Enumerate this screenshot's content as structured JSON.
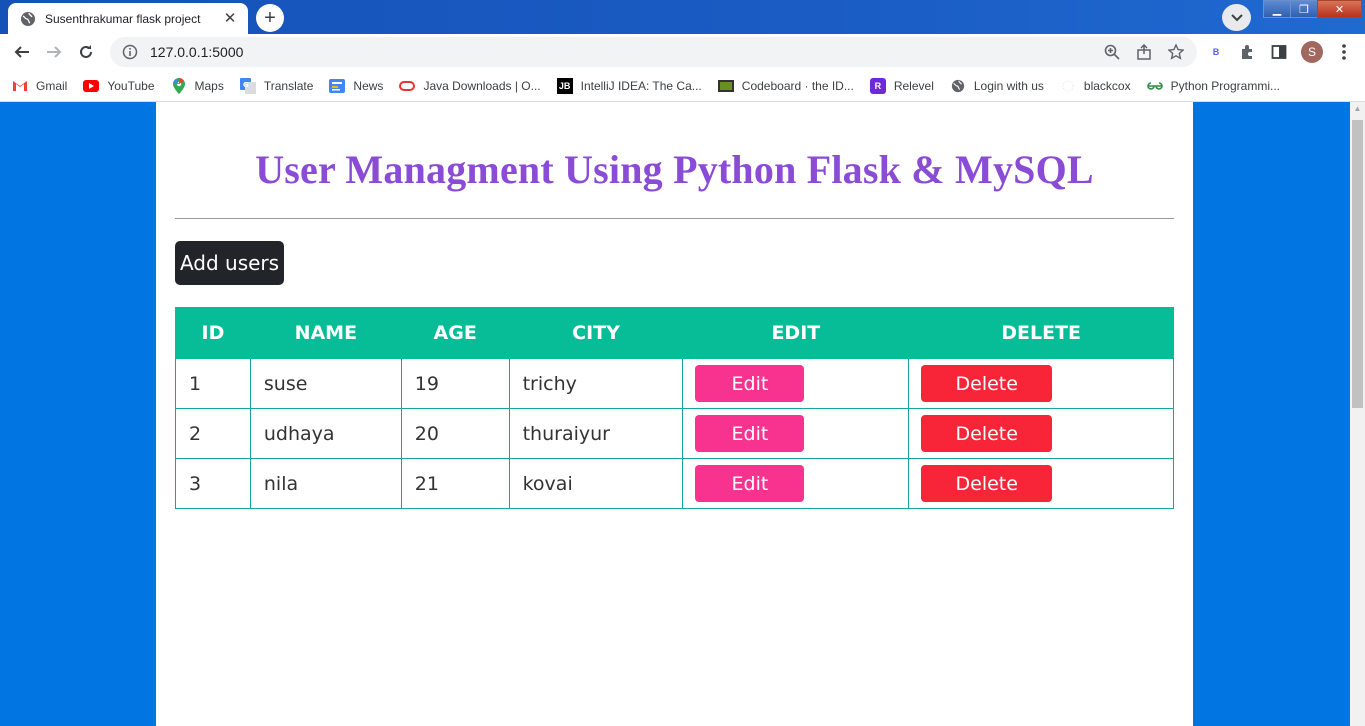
{
  "browser": {
    "tab_title": "Susenthrakumar flask project",
    "tab_close": "✕",
    "new_tab": "+",
    "url": "127.0.0.1:5000",
    "profile_initial": "S",
    "window_controls": {
      "minimize": "▁",
      "restore": "❐",
      "close": "✕"
    }
  },
  "bookmarks": [
    {
      "label": "Gmail",
      "icon": "gmail-icon"
    },
    {
      "label": "YouTube",
      "icon": "youtube-icon"
    },
    {
      "label": "Maps",
      "icon": "maps-icon"
    },
    {
      "label": "Translate",
      "icon": "translate-icon"
    },
    {
      "label": "News",
      "icon": "news-icon"
    },
    {
      "label": "Java Downloads | O...",
      "icon": "oracle-icon"
    },
    {
      "label": "IntelliJ IDEA: The Ca...",
      "icon": "intellij-icon"
    },
    {
      "label": "Codeboard · the ID...",
      "icon": "codeboard-icon"
    },
    {
      "label": "Relevel",
      "icon": "relevel-icon"
    },
    {
      "label": "Login with us",
      "icon": "globe-icon"
    },
    {
      "label": "blackcox",
      "icon": "blackcox-icon"
    },
    {
      "label": "Python Programmi...",
      "icon": "geeksforgeeks-icon"
    }
  ],
  "page": {
    "title": "User Managment Using Python Flask & MySQL",
    "add_button": "Add users",
    "table": {
      "headers": [
        "ID",
        "NAME",
        "AGE",
        "CITY",
        "EDIT",
        "DELETE"
      ],
      "rows": [
        {
          "id": "1",
          "name": "suse",
          "age": "19",
          "city": "trichy",
          "edit": "Edit",
          "delete": "Delete"
        },
        {
          "id": "2",
          "name": "udhaya",
          "age": "20",
          "city": "thuraiyur",
          "edit": "Edit",
          "delete": "Delete"
        },
        {
          "id": "3",
          "name": "nila",
          "age": "21",
          "city": "kovai",
          "edit": "Edit",
          "delete": "Delete"
        }
      ]
    }
  },
  "colors": {
    "page_background": "#0176e3",
    "title": "#8a4bd6",
    "table_header": "#06bd98",
    "edit_button": "#f7338f",
    "delete_button": "#f82437",
    "add_button": "#212529"
  }
}
